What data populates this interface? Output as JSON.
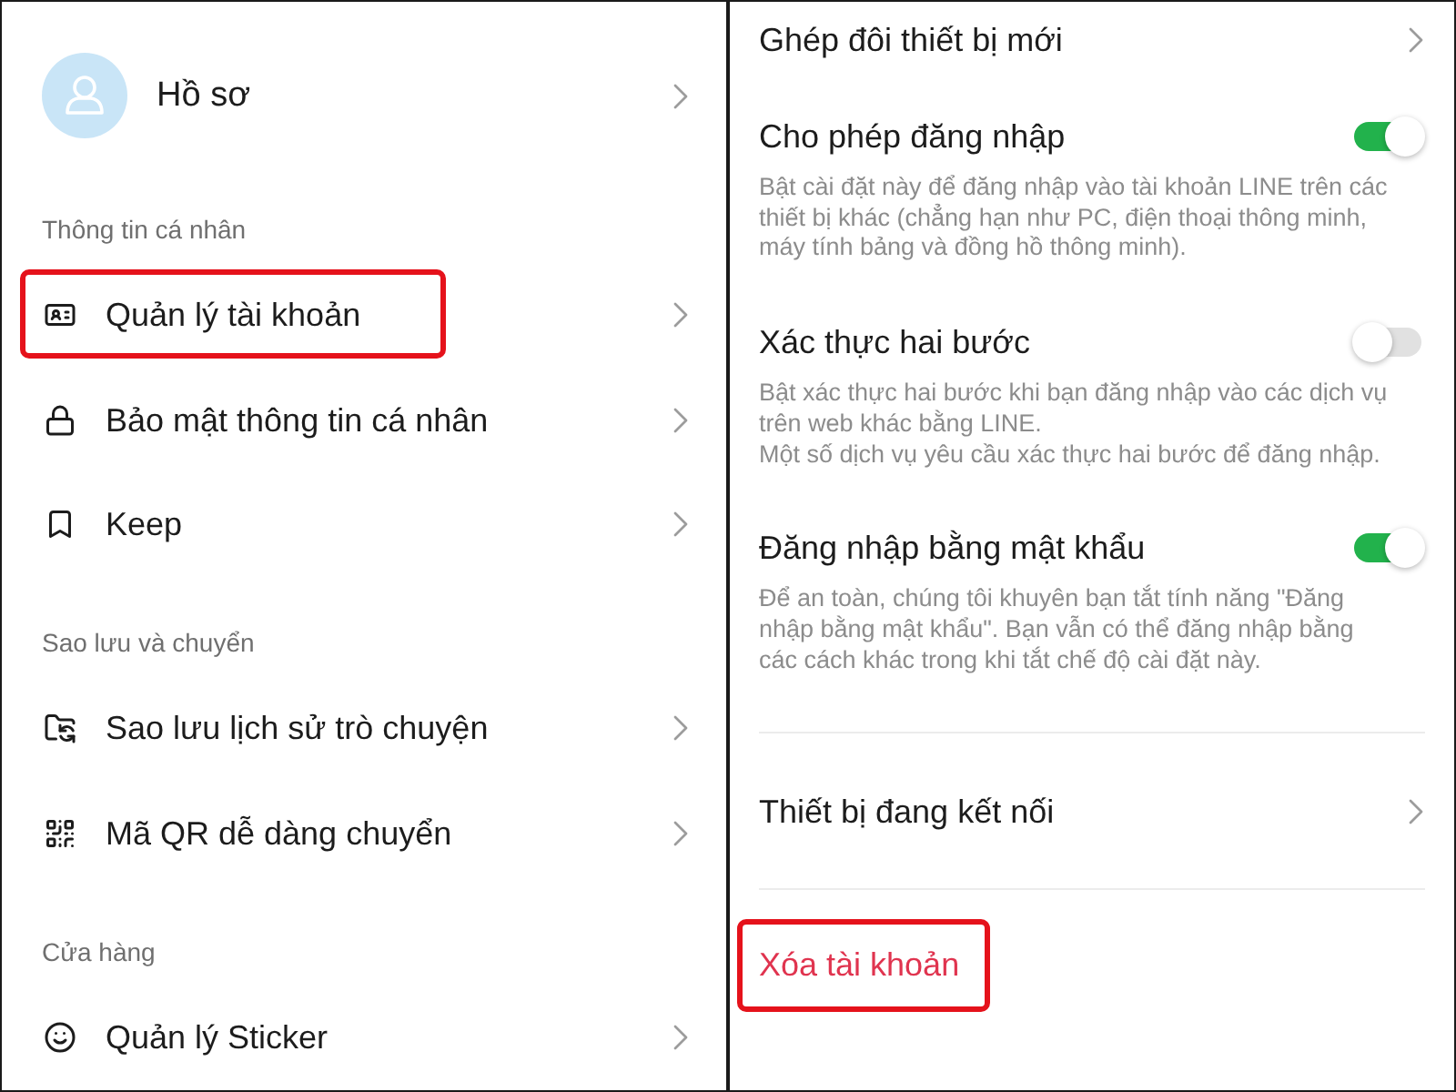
{
  "profile": {
    "label": "Hồ sơ"
  },
  "sections": [
    {
      "title": "Thông tin cá nhân",
      "items": [
        {
          "label": "Quản lý tài khoản",
          "highlighted": true
        },
        {
          "label": "Bảo mật thông tin cá nhân",
          "highlighted": false
        },
        {
          "label": "Keep",
          "highlighted": false
        }
      ]
    },
    {
      "title": "Sao lưu và chuyển",
      "items": [
        {
          "label": "Sao lưu lịch sử trò chuyện",
          "highlighted": false
        },
        {
          "label": "Mã QR dễ dàng chuyển",
          "highlighted": false
        }
      ]
    },
    {
      "title": "Cửa hàng",
      "items": [
        {
          "label": "Quản lý Sticker",
          "highlighted": false
        }
      ]
    }
  ],
  "settings": [
    {
      "kind": "link",
      "label": "Ghép đôi thiết bị mới",
      "highlighted": false
    },
    {
      "kind": "toggle",
      "label": "Cho phép đăng nhập",
      "on": true,
      "highlighted": false,
      "description": [
        "Bật cài đặt này để đăng nhập vào tài khoản LINE trên các thiết bị khác (chẳng hạn như PC, điện thoại thông minh, máy tính bảng và đồng hồ thông minh)."
      ]
    },
    {
      "kind": "toggle",
      "label": "Xác thực hai bước",
      "on": false,
      "highlighted": false,
      "description": [
        "Bật xác thực hai bước khi bạn đăng nhập vào các dịch vụ trên web khác bằng LINE.",
        "Một số dịch vụ yêu cầu xác thực hai bước để đăng nhập."
      ]
    },
    {
      "kind": "toggle",
      "label": "Đăng nhập bằng mật khẩu",
      "on": true,
      "highlighted": false,
      "description": [
        "Để an toàn, chúng tôi khuyên bạn tắt tính năng \"Đăng nhập bằng mật khẩu\". Bạn vẫn có thể đăng nhập bằng các cách khác trong khi tắt chế độ cài đặt này."
      ]
    },
    {
      "kind": "link",
      "label": "Thiết bị đang kết nối",
      "highlighted": false
    },
    {
      "kind": "danger",
      "label": "Xóa tài khoản",
      "highlighted": true
    }
  ]
}
